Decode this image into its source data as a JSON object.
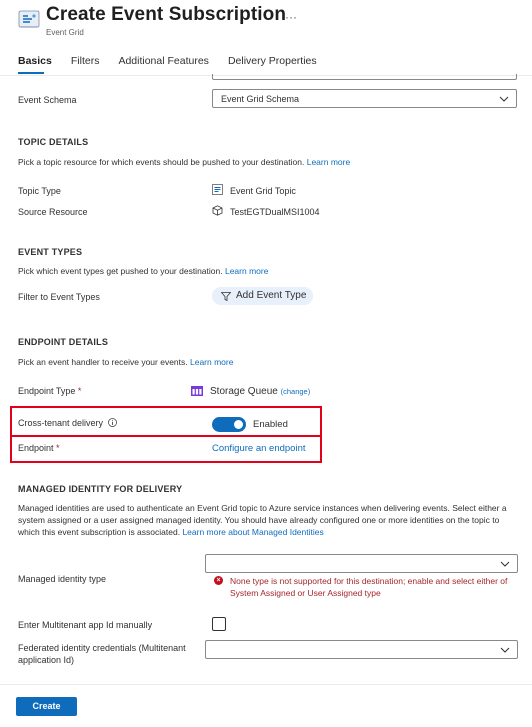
{
  "header": {
    "title": "Create Event Subscription",
    "subtitle": "Event Grid",
    "more_label": "···",
    "icon": "event-grid-icon"
  },
  "tabs": [
    {
      "label": "Basics",
      "active": true
    },
    {
      "label": "Filters",
      "active": false
    },
    {
      "label": "Additional Features",
      "active": false
    },
    {
      "label": "Delivery Properties",
      "active": false
    }
  ],
  "event_schema": {
    "label": "Event Schema",
    "value": "Event Grid Schema"
  },
  "topic_details": {
    "title": "TOPIC DETAILS",
    "description": "Pick a topic resource for which events should be pushed to your destination.",
    "learn_more": "Learn more",
    "topic_type_label": "Topic Type",
    "topic_type_value": "Event Grid Topic",
    "source_resource_label": "Source Resource",
    "source_resource_value": "TestEGTDualMSI1004"
  },
  "event_types": {
    "title": "EVENT TYPES",
    "description": "Pick which event types get pushed to your destination.",
    "learn_more": "Learn more",
    "filter_label": "Filter to Event Types",
    "add_button": "Add Event Type"
  },
  "endpoint_details": {
    "title": "ENDPOINT DETAILS",
    "description": "Pick an event handler to receive your events.",
    "learn_more": "Learn more",
    "endpoint_type_label": "Endpoint Type",
    "required_mark": "*",
    "endpoint_type_value": "Storage Queue",
    "change_label": "(change)",
    "cross_tenant_label": "Cross-tenant delivery",
    "cross_tenant_state": "Enabled",
    "endpoint_label": "Endpoint",
    "configure_link": "Configure an endpoint"
  },
  "managed_identity": {
    "title": "MANAGED IDENTITY FOR DELIVERY",
    "description": "Managed identities are used to authenticate an Event Grid topic to Azure service instances when delivering events. Select either a system assigned or a user assigned managed identity. You should have already configured one or more identities on the topic to which this event subscription is associated.",
    "learn_more": "Learn more about Managed Identities",
    "type_label": "Managed identity type",
    "type_value": "",
    "error": "None type is not supported for this destination; enable and select either of System Assigned or User Assigned type",
    "multitenant_label": "Enter Multitenant app Id manually",
    "multitenant_checked": false,
    "federated_label": "Federated identity credentials (Multitenant application Id)",
    "federated_value": ""
  },
  "footer": {
    "create_label": "Create"
  },
  "colors": {
    "accent": "#0f6cbd",
    "error": "#a4262c",
    "highlight": "#e3001b"
  }
}
